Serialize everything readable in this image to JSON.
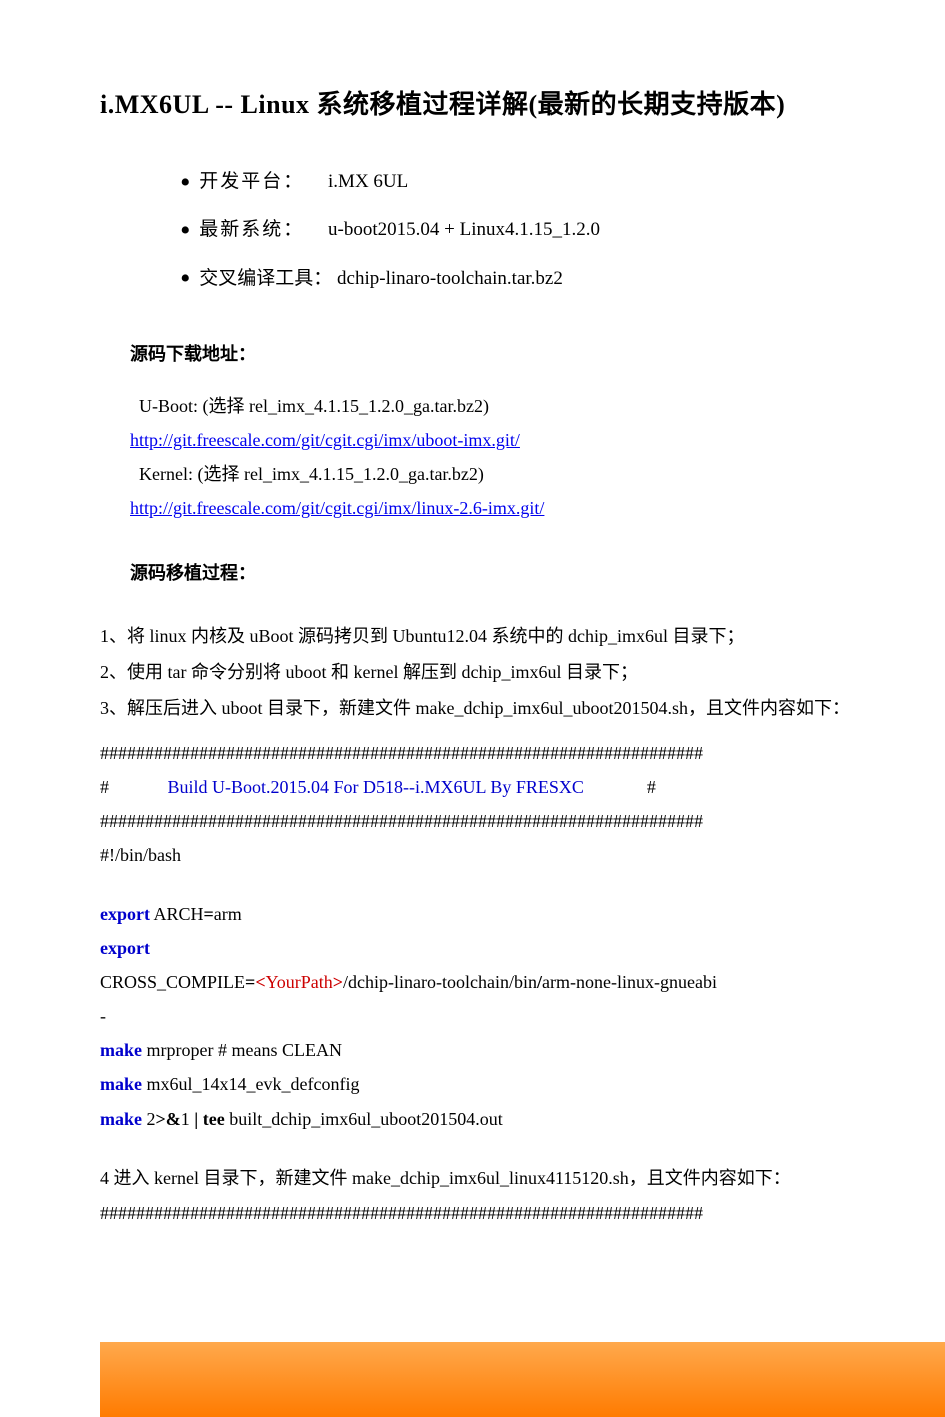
{
  "title": "i.MX6UL -- Linux 系统移植过程详解(最新的长期支持版本)",
  "bullets": {
    "platform_label": "开发平台：",
    "platform_value": "i.MX 6UL",
    "system_label": "最新系统：",
    "system_value": "u-boot2015.04 + Linux4.1.15_1.2.0",
    "tool_label": "交叉编译工具：",
    "tool_value": "dchip-linaro-toolchain.tar.bz2"
  },
  "source_header": "源码下载地址：",
  "source": {
    "uboot_label": "U-Boot: (选择 rel_imx_4.1.15_1.2.0_ga.tar.bz2)",
    "uboot_link": "http://git.freescale.com/git/cgit.cgi/imx/uboot-imx.git/",
    "kernel_label": "Kernel: (选择 rel_imx_4.1.15_1.2.0_ga.tar.bz2)",
    "kernel_link": "http://git.freescale.com/git/cgit.cgi/imx/linux-2.6-imx.git/"
  },
  "proc_header": "源码移植过程：",
  "steps": {
    "s1": "1、将 linux 内核及 uBoot 源码拷贝到 Ubuntu12.04 系统中的 dchip_imx6ul 目录下；",
    "s2": "2、使用 tar 命令分别将 uboot 和 kernel 解压到 dchip_imx6ul 目录下；",
    "s3": "3、解压后进入 uboot 目录下，新建文件 make_dchip_imx6ul_uboot201504.sh，且文件内容如下："
  },
  "hash1": "###################################################################",
  "banner_hash_open": "#",
  "banner_text": "Build U-Boot.2015.04 For D518--i.MX6UL   By FRESXC",
  "banner_hash_close": "#",
  "hash2": "###################################################################",
  "shebang": "#!/bin/bash",
  "code": {
    "export1_kw": "export",
    "export1_rest": " ARCH",
    "export1_eq": "=",
    "export1_val": "arm",
    "export2_kw": "export",
    "cross_pre": "CROSS_COMPILE",
    "cross_eq": "=",
    "cross_lt": "<",
    "cross_mid": "YourPath",
    "cross_gt": ">",
    "cross_rest1": "/dchip-linaro-toolchain/bin",
    "cross_rest2": "/",
    "cross_rest3": "arm-none-linux-gnueabi",
    "dash": "-",
    "make1_kw": "make",
    "make1_rest": " mrproper   # means CLEAN",
    "make2_kw": "make",
    "make2_rest": " mx6ul_14x14_evk_defconfig",
    "make3_kw": "make",
    "make3_num": " 2",
    "make3_op1": ">&",
    "make3_one": "1 ",
    "make3_pipe": "|",
    "make3_tee": " tee",
    "make3_rest": " built_dchip_imx6ul_uboot201504.out"
  },
  "step4": "4 进入 kernel 目录下，新建文件 make_dchip_imx6ul_linux4115120.sh，且文件内容如下：",
  "hash3": "###################################################################"
}
